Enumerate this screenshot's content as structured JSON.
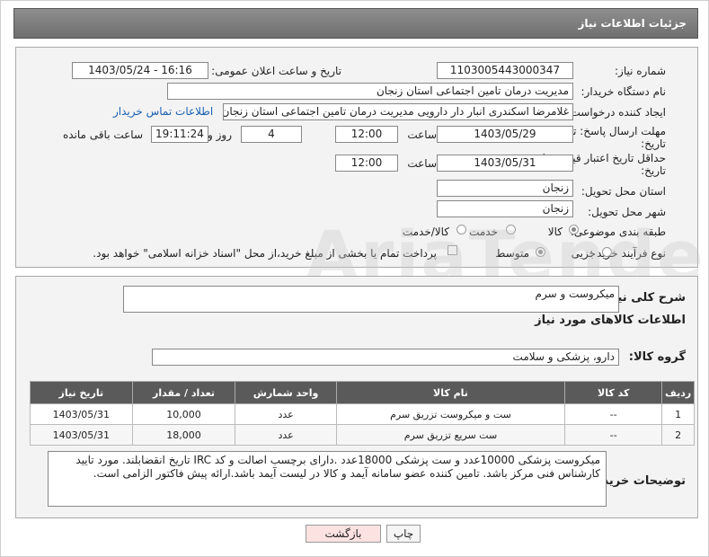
{
  "header": {
    "title": "جزئیات اطلاعات نیاز"
  },
  "form": {
    "need_number_label": "شماره نیاز:",
    "need_number": "1103005443000347",
    "announce_label": "تاریخ و ساعت اعلان عمومی:",
    "announce_value": "1403/05/24 - 16:16",
    "buyer_org_label": "نام دستگاه خریدار:",
    "buyer_org": "مدیریت درمان تامین اجتماعی استان زنجان",
    "creator_label": "ایجاد کننده درخواست:",
    "creator": "غلامرضا  اسکندری انبار دار دارویی مدیریت درمان تامین اجتماعی استان زنجان",
    "buyer_contact_link": "اطلاعات تماس خریدار",
    "deadline_label": "مهلت ارسال پاسخ: تا تاریخ:",
    "deadline_date": "1403/05/29",
    "time_label": "ساعت",
    "deadline_time": "12:00",
    "days_value": "4",
    "days_label": "روز و",
    "remaining_time": "19:11:24",
    "remaining_label": "ساعت باقی مانده",
    "validity_label": "حداقل تاریخ اعتبار قیمت: تا تاریخ:",
    "validity_date": "1403/05/31",
    "validity_time_label": "ساعت",
    "validity_time": "12:00",
    "province_label": "استان محل تحویل:",
    "province": "زنجان",
    "city_label": "شهر محل تحویل:",
    "city": "زنجان",
    "category_label": "طبقه بندی موضوعی:",
    "category_options": [
      "کالا",
      "خدمت",
      "کالا/خدمت"
    ],
    "process_label": "نوع فرآیند خرید :",
    "process_options": [
      "جزیی",
      "متوسط"
    ],
    "payment_note": "پرداخت تمام یا بخشی از مبلغ خرید،از محل \"اسناد خزانه اسلامی\" خواهد بود."
  },
  "details": {
    "general_desc_label": "شرح کلی نیاز:",
    "general_desc": "میکروست و سرم",
    "goods_info_title": "اطلاعات کالاهای مورد نیاز",
    "goods_group_label": "گروه کالا:",
    "goods_group": "دارو، پزشکی و سلامت",
    "table": {
      "headers": [
        "ردیف",
        "کد کالا",
        "نام کالا",
        "واحد شمارش",
        "تعداد / مقدار",
        "تاریخ نیاز"
      ],
      "rows": [
        [
          "1",
          "--",
          "ست و میکروست تزریق سرم",
          "عدد",
          "10,000",
          "1403/05/31"
        ],
        [
          "2",
          "--",
          "ست سریع تزریق سرم",
          "عدد",
          "18,000",
          "1403/05/31"
        ]
      ]
    },
    "buyer_notes_label": "توضیحات خریدار:",
    "buyer_notes": "میکروست پزشکی 10000عدد و ست پزشکی 18000عدد .دارای برچسب اصالت و کد IRC تاریخ انقضابلند. مورد تایید کارشناس فنی مرکز باشد. تامین کننده عضو سامانه آیمد و کالا در لیست آیمد باشد.ارائه پیش فاکتور الزامی است."
  },
  "buttons": {
    "print": "چاپ",
    "back": "بازگشت"
  }
}
